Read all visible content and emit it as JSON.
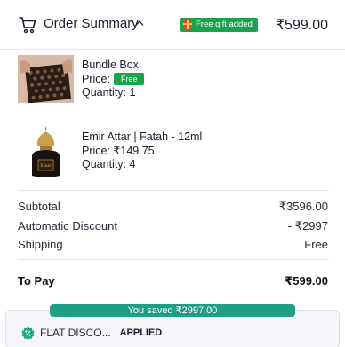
{
  "header": {
    "title": "Order Summary",
    "gift_badge": "Free gift added",
    "total": "₹599.00"
  },
  "items": [
    {
      "name": "Bundle Box",
      "price_label": "Price:",
      "price_value": "Free",
      "quantity": "Quantity: 1"
    },
    {
      "name": "Emir Attar | Fatah - 12ml",
      "price": "Price: ₹149.75",
      "quantity": "Quantity: 4"
    }
  ],
  "summary": {
    "subtotal_label": "Subtotal",
    "subtotal_value": "₹3596.00",
    "discount_label": "Automatic Discount",
    "discount_value": "- ₹2997",
    "shipping_label": "Shipping",
    "shipping_value": "Free",
    "topay_label": "To Pay",
    "topay_value": "₹599.00"
  },
  "savings": {
    "banner": "You saved ₹2997.00",
    "coupon_name": "FLAT DISCO...",
    "coupon_status": "APPLIED"
  },
  "colors": {
    "accent_green": "#1aa34a",
    "savings_teal": "#1f9e86"
  }
}
